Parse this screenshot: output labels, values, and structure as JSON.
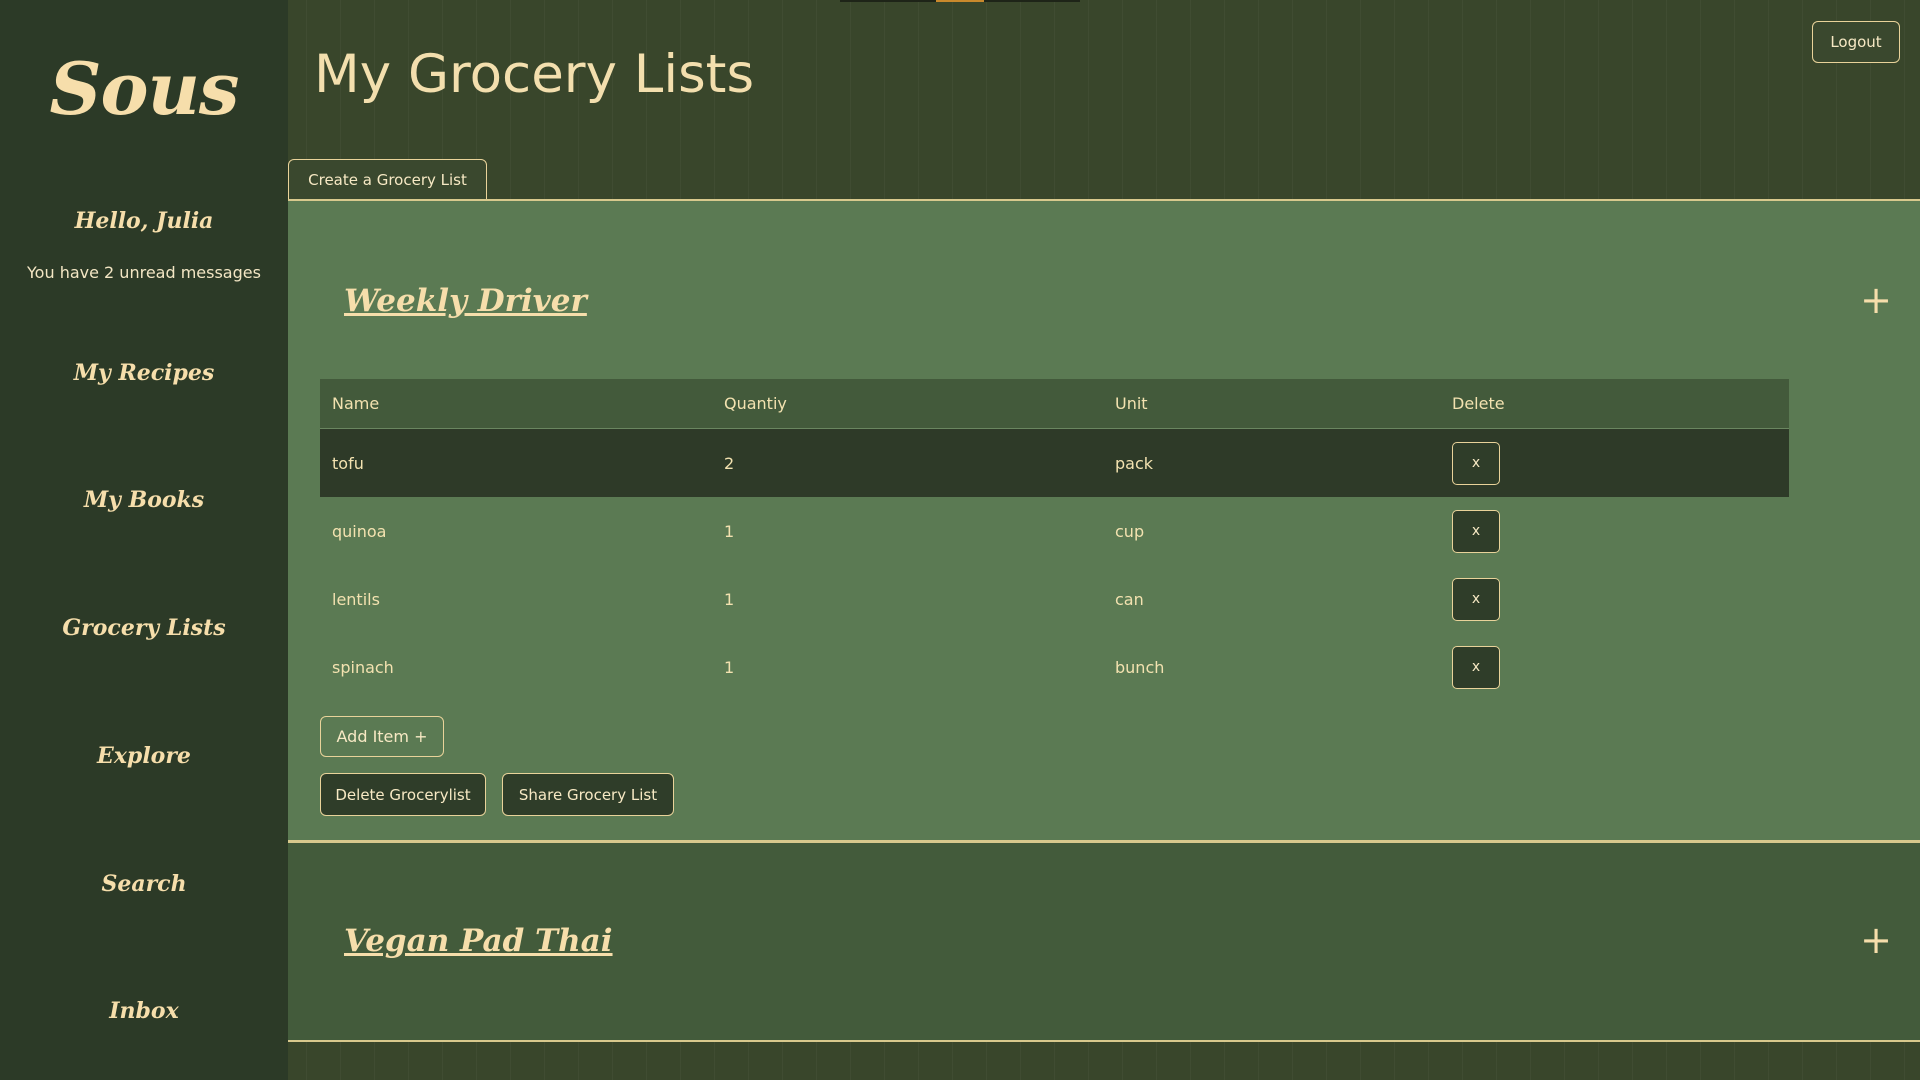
{
  "app": {
    "logo": "Sous"
  },
  "sidebar": {
    "greeting": "Hello, Julia",
    "unread_text": "You have 2 unread messages",
    "items": [
      {
        "label": "My Recipes"
      },
      {
        "label": "My Books"
      },
      {
        "label": "Grocery Lists"
      },
      {
        "label": "Explore"
      },
      {
        "label": "Search"
      },
      {
        "label": "Inbox"
      }
    ]
  },
  "header": {
    "title": "My Grocery Lists",
    "logout_label": "Logout",
    "create_label": "Create a Grocery List"
  },
  "lists": [
    {
      "title": "Weekly Driver",
      "expanded": true,
      "toggle_icon": "+",
      "columns": [
        "Name",
        "Quantiy",
        "Unit",
        "Delete"
      ],
      "rows": [
        {
          "name": "tofu",
          "quantity": "2",
          "unit": "pack",
          "delete_label": "x"
        },
        {
          "name": "quinoa",
          "quantity": "1",
          "unit": "cup",
          "delete_label": "x"
        },
        {
          "name": "lentils",
          "quantity": "1",
          "unit": "can",
          "delete_label": "x"
        },
        {
          "name": "spinach",
          "quantity": "1",
          "unit": "bunch",
          "delete_label": "x"
        }
      ],
      "add_item_label": "Add Item +",
      "delete_list_label": "Delete Grocerylist",
      "share_list_label": "Share Grocery List"
    },
    {
      "title": "Vegan Pad Thai",
      "expanded": false,
      "toggle_icon": "+"
    }
  ],
  "colors": {
    "accent": "#f6deab",
    "sidebar_bg": "#2c3a27",
    "page_bg": "#39462b",
    "open_list_bg": "#5b7a53",
    "closed_list_bg": "#435b3b"
  }
}
